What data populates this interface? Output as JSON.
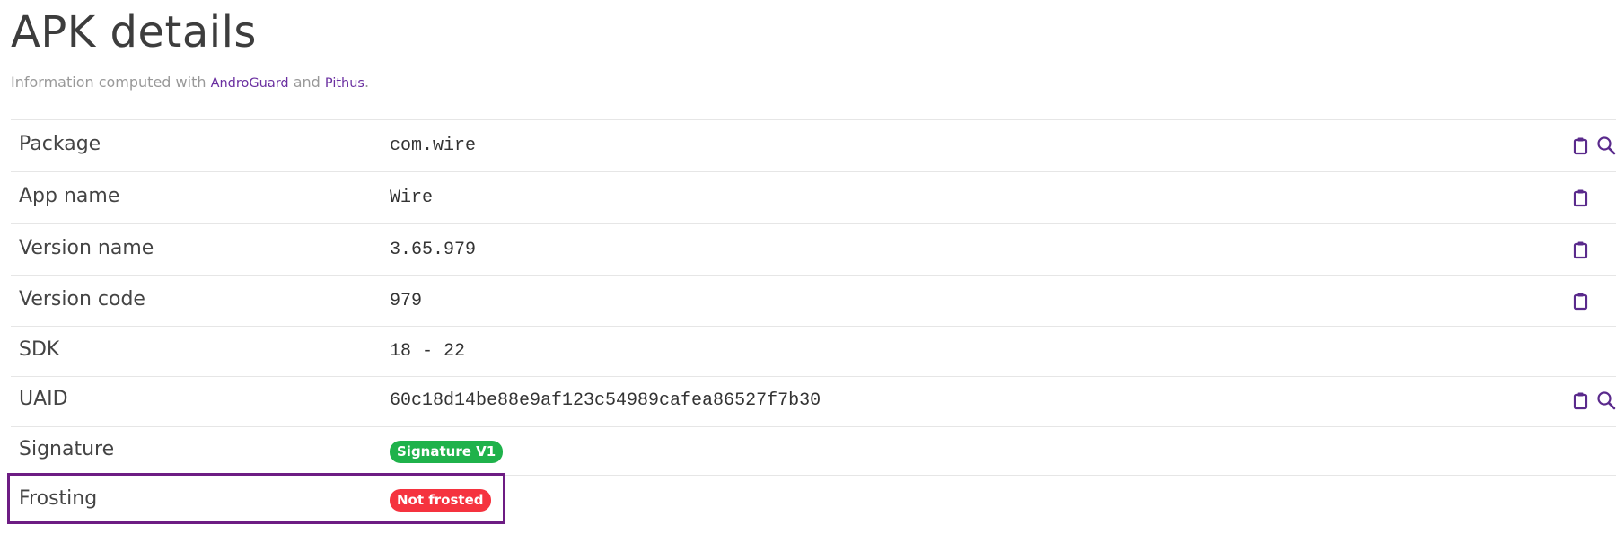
{
  "header": {
    "title": "APK details",
    "subtitle_prefix": "Information computed with ",
    "subtitle_link1": "AndroGuard",
    "subtitle_and": " and ",
    "subtitle_link2": "Pithus",
    "subtitle_suffix": "."
  },
  "rows": [
    {
      "label": "Package",
      "value": "com.wire",
      "copy": true,
      "search": true
    },
    {
      "label": "App name",
      "value": "Wire",
      "copy": true,
      "search": false
    },
    {
      "label": "Version name",
      "value": "3.65.979",
      "copy": true,
      "search": false
    },
    {
      "label": "Version code",
      "value": "979",
      "copy": true,
      "search": false
    },
    {
      "label": "SDK",
      "value": "18 - 22",
      "copy": false,
      "search": false
    },
    {
      "label": "UAID",
      "value": "60c18d14be88e9af123c54989cafea86527f7b30",
      "copy": true,
      "search": true
    },
    {
      "label": "Signature",
      "badge": "Signature V1",
      "badge_color": "#1fb24b"
    },
    {
      "label": "Frosting",
      "badge": "Not frosted",
      "badge_color": "#f5333f"
    }
  ],
  "icons": {
    "copy": "clipboard-icon",
    "search": "magnifier-icon"
  },
  "colors": {
    "accent": "#6a2fa0",
    "highlight_border": "#6d1c83"
  }
}
